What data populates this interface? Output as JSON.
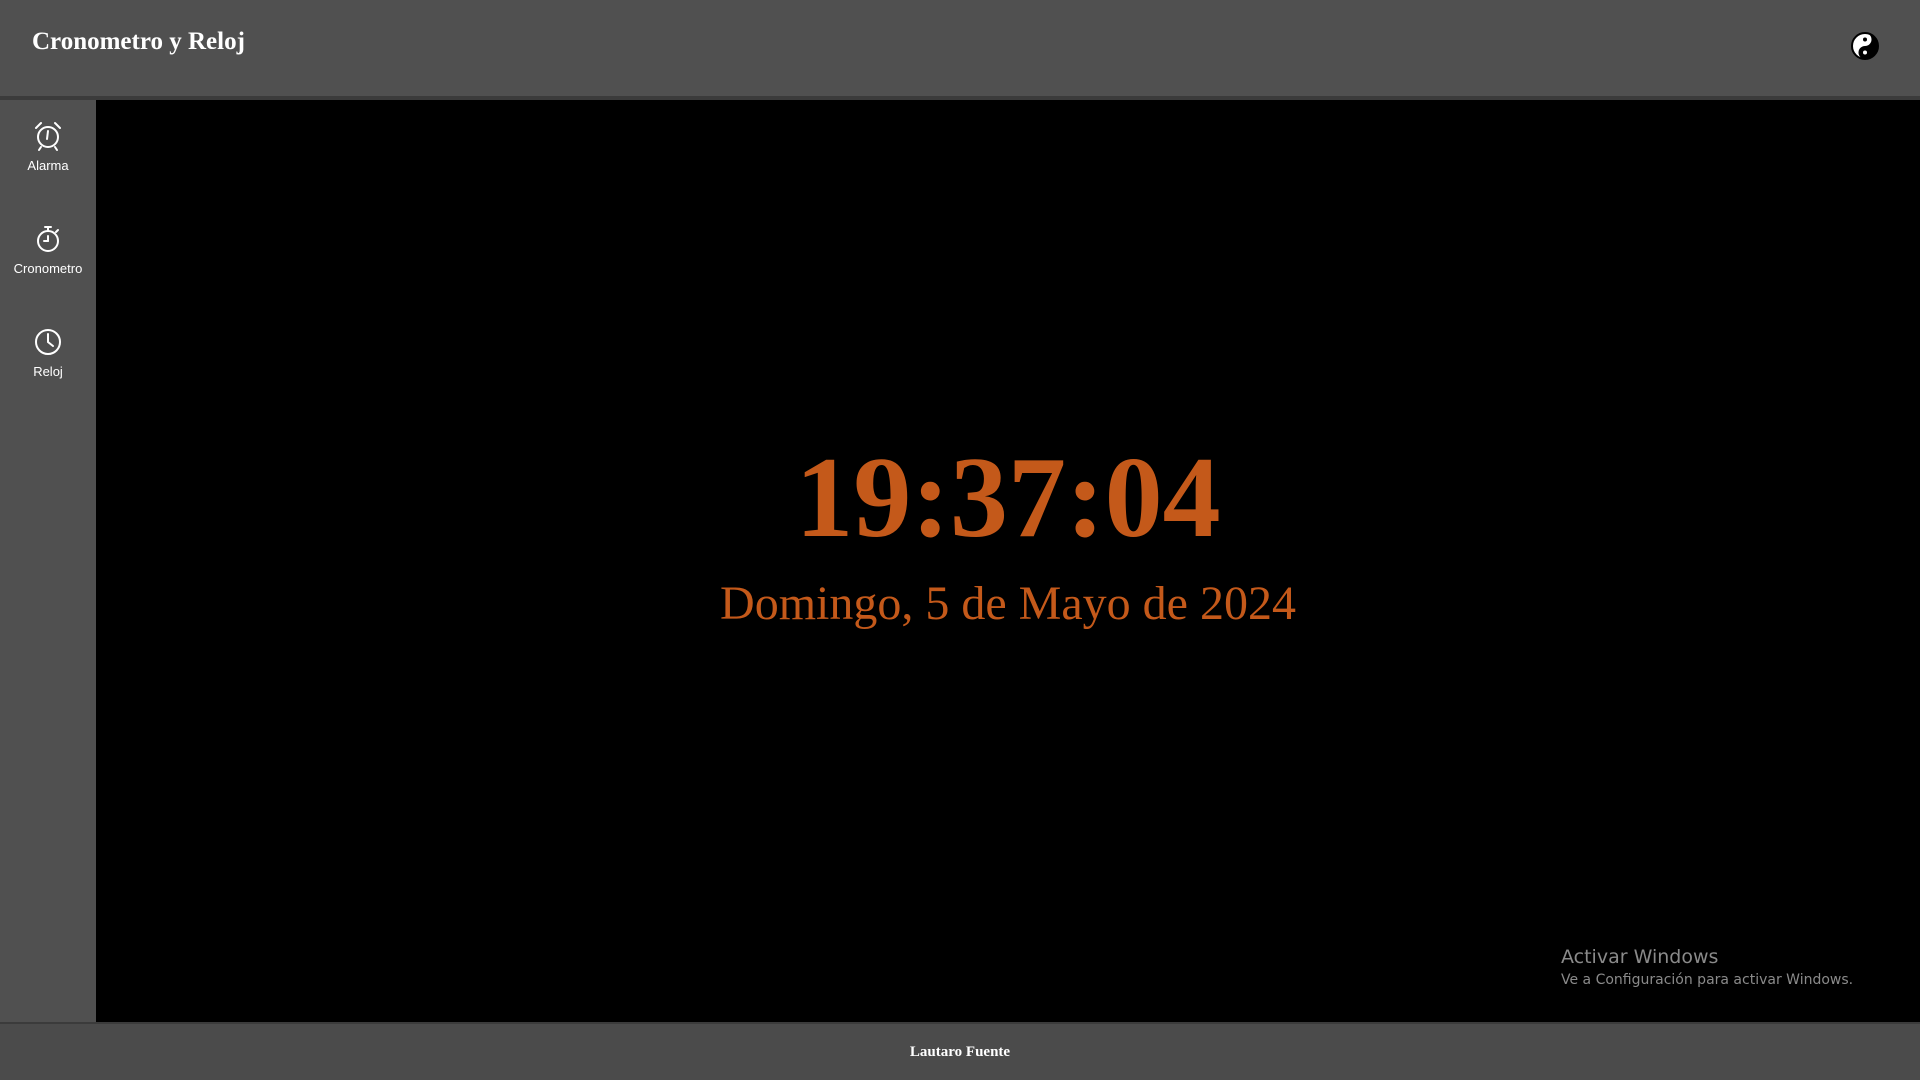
{
  "header": {
    "title": "Cronometro y Reloj",
    "theme_toggle_icon": "yin-yang-icon"
  },
  "sidebar": {
    "items": [
      {
        "label": "Alarma",
        "icon": "alarm-clock-icon"
      },
      {
        "label": "Cronometro",
        "icon": "stopwatch-icon"
      },
      {
        "label": "Reloj",
        "icon": "clock-icon"
      }
    ]
  },
  "main": {
    "time": "19:37:04",
    "date": "Domingo, 5 de Mayo de 2024",
    "accent_color": "#c4591a"
  },
  "watermark": {
    "title": "Activar Windows",
    "subtitle": "Ve a Configuración para activar Windows."
  },
  "footer": {
    "author": "Lautaro Fuente"
  }
}
